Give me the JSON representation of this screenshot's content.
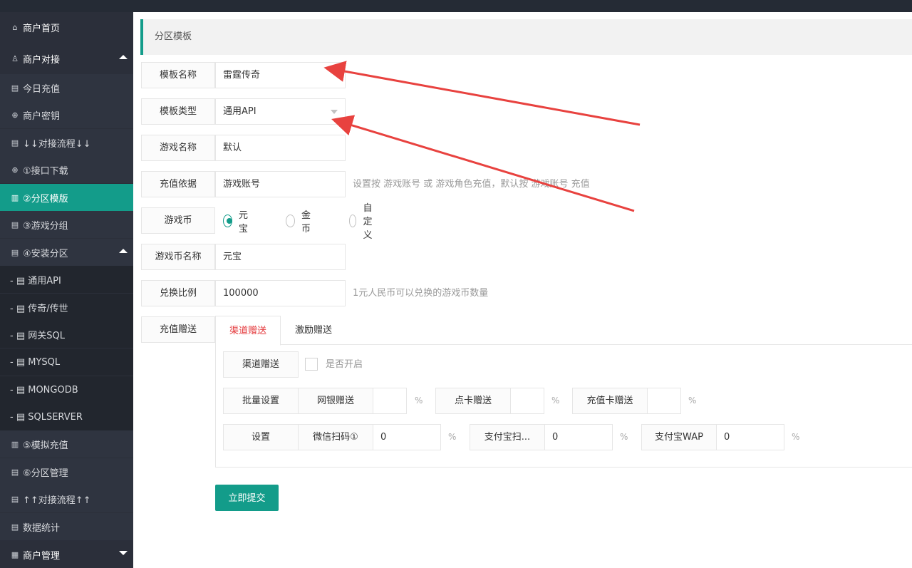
{
  "colors": {
    "accent": "#139c8a",
    "sidebar_bg": "#2b2f3a",
    "arrow": "#e8423f",
    "tab_active": "#e4393c"
  },
  "sidebar": {
    "items": [
      {
        "label": "商户首页",
        "icon": "home-icon",
        "glyph": "⌂"
      },
      {
        "label": "商户对接",
        "icon": "user-icon",
        "glyph": "♙"
      },
      {
        "label": "今日充值",
        "icon": "doc-icon",
        "glyph": "▤"
      },
      {
        "label": "商户密钥",
        "icon": "download-icon",
        "glyph": "⊕"
      },
      {
        "label": "↓↓对接流程↓↓",
        "icon": "doc-icon",
        "glyph": "▤"
      },
      {
        "label": "①接口下载",
        "icon": "download-icon",
        "glyph": "⊕"
      },
      {
        "label": "②分区模版",
        "icon": "server-icon",
        "glyph": "▥"
      },
      {
        "label": "③游戏分组",
        "icon": "doc-icon",
        "glyph": "▤"
      },
      {
        "label": "④安装分区",
        "icon": "doc-icon",
        "glyph": "▤"
      },
      {
        "label": "- ▤ 通用API",
        "icon": "doc-icon",
        "glyph": ""
      },
      {
        "label": "- ▤ 传奇/传世",
        "icon": "doc-icon",
        "glyph": ""
      },
      {
        "label": "- ▤ 网关SQL",
        "icon": "doc-icon",
        "glyph": ""
      },
      {
        "label": "- ▤ MYSQL",
        "icon": "doc-icon",
        "glyph": ""
      },
      {
        "label": "- ▤ MONGODB",
        "icon": "doc-icon",
        "glyph": ""
      },
      {
        "label": "- ▤ SQLSERVER",
        "icon": "doc-icon",
        "glyph": ""
      },
      {
        "label": "⑤模拟充值",
        "icon": "server-icon",
        "glyph": "▥"
      },
      {
        "label": "⑥分区管理",
        "icon": "doc-icon",
        "glyph": "▤"
      },
      {
        "label": "↑↑对接流程↑↑",
        "icon": "doc-icon",
        "glyph": "▤"
      },
      {
        "label": "数据统计",
        "icon": "doc-icon",
        "glyph": "▤"
      },
      {
        "label": "商户管理",
        "icon": "grid-icon",
        "glyph": "▦"
      }
    ]
  },
  "breadcrumb": "分区模板",
  "form": {
    "template_name": {
      "label": "模板名称",
      "value": "雷霆传奇"
    },
    "template_type": {
      "label": "模板类型",
      "value": "通用API"
    },
    "game_name": {
      "label": "游戏名称",
      "value": "默认"
    },
    "recharge_basis": {
      "label": "充值依据",
      "value": "游戏账号",
      "hint": "设置按 游戏账号 或 游戏角色充值，默认按 游戏账号 充值"
    },
    "game_currency": {
      "label": "游戏币",
      "options": [
        "元宝",
        "金币",
        "自定义"
      ],
      "selected": "元宝"
    },
    "currency_name": {
      "label": "游戏币名称",
      "value": "元宝"
    },
    "exchange_ratio": {
      "label": "兑换比例",
      "value": "100000",
      "hint": "1元人民币可以兑换的游戏币数量"
    },
    "recharge_bonus": {
      "label": "充值赠送"
    }
  },
  "tabs": {
    "channel": "渠道赠送",
    "incentive": "激励赠送",
    "active": "渠道赠送"
  },
  "channel": {
    "enable_label": "渠道赠送",
    "enable_text": "是否开启",
    "batch_label": "批量设置",
    "bank_label": "网银赠送",
    "card_label": "点卡赠送",
    "recharge_card_label": "充值卡赠送",
    "set_label": "设置",
    "wechat_label": "微信扫码①",
    "wechat_value": "0",
    "alipay_scan_label": "支付宝扫...",
    "alipay_scan_value": "0",
    "alipay_wap_label": "支付宝WAP",
    "alipay_wap_value": "0",
    "percent": "%"
  },
  "submit_label": "立即提交"
}
